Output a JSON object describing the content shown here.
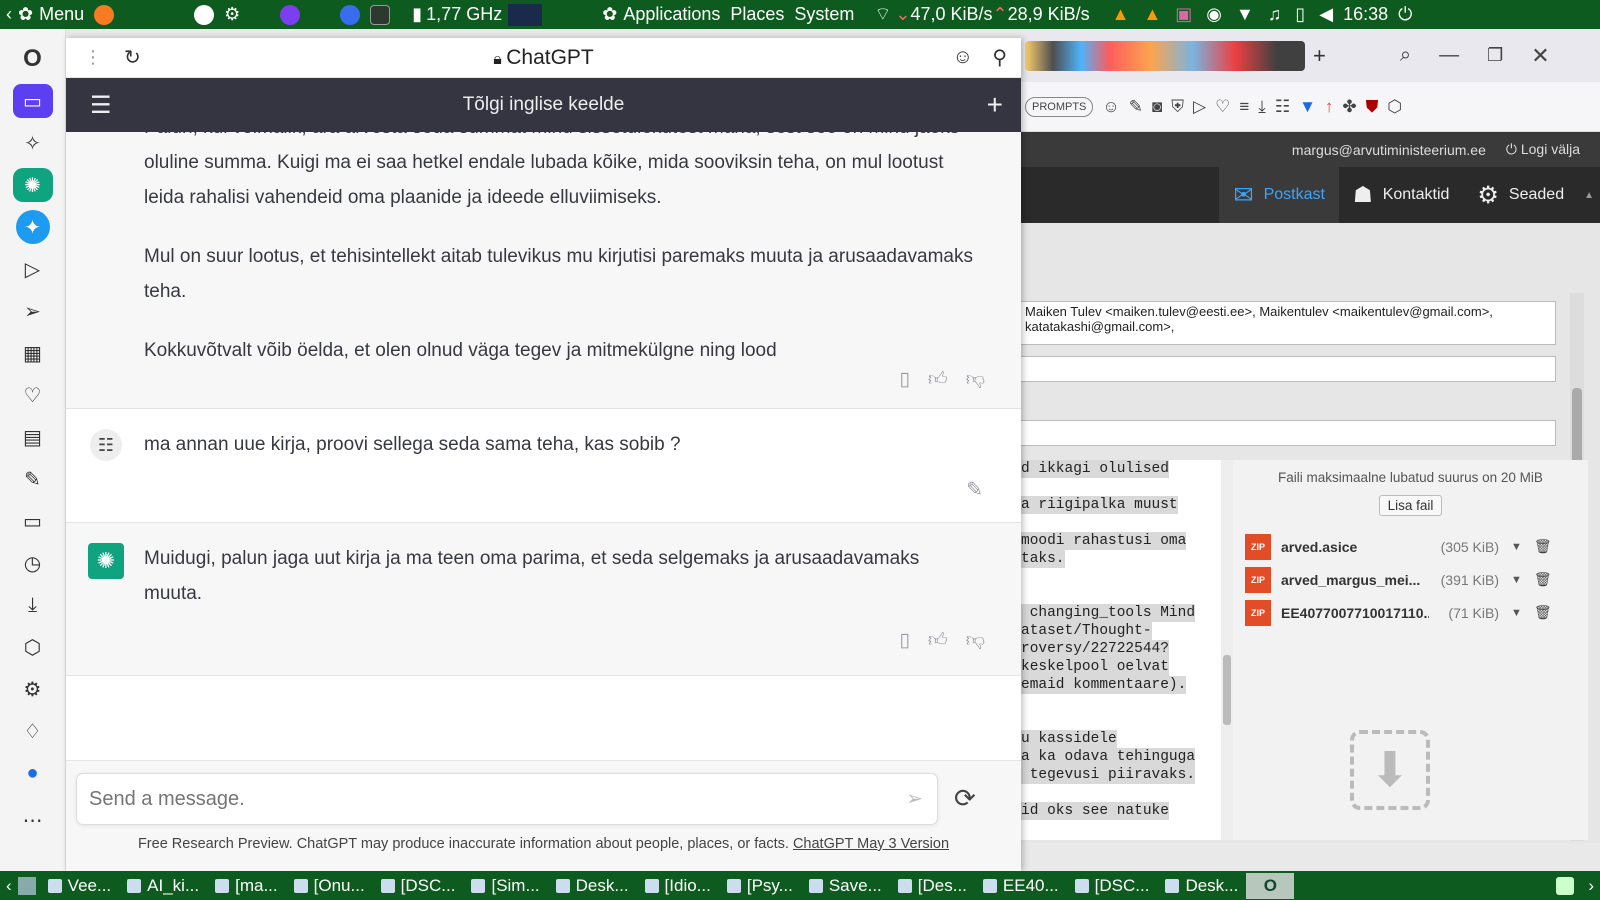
{
  "system": {
    "menu_label": "Menu",
    "cpu_freq": "1,77 GHz",
    "applications": "Applications",
    "places": "Places",
    "system_label": "System",
    "net_down": "47,0 KiB/s",
    "net_up": "28,9 KiB/s",
    "clock": "16:38"
  },
  "popup": {
    "title": "ChatGPT",
    "chat_title": "Tõlgi inglise keelde",
    "message1_paragraphs": [
      "Palun, kui võimalik, ära arvesta seda summat minu sissetulekutest maha, sest see on minu jaoks oluline summa. Kuigi ma ei saa hetkel endale lubada kõike, mida sooviksin teha, on mul lootust leida rahalisi vahendeid oma plaanide ja ideede elluviimiseks.",
      "Mul on suur lootus, et tehisintellekt aitab tulevikus mu kirjutisi paremaks muuta ja arusaadavamaks teha.",
      "Kokkuvõtvalt võib öelda, et olen olnud väga tegev ja mitmekülgne ning lood"
    ],
    "user_message": "ma annan uue kirja, proovi sellega seda sama teha, kas sobib ?",
    "ai_reply": "Muidugi, palun jaga uut kirja ja ma teen oma parima, et seda selgemaks ja arusaadavamaks muuta.",
    "input_placeholder": "Send a message.",
    "disclaimer": "Free Research Preview. ChatGPT may produce inaccurate information about people, places, or facts.",
    "version_link": "ChatGPT May 3 Version"
  },
  "toolbar": {
    "prompts_label": "PROMPTS"
  },
  "mail": {
    "user_email": "margus@arvutiministeerium.ee",
    "logout": "Logi välja",
    "nav": [
      "Postkast",
      "Kontaktid",
      "Seaded"
    ],
    "recipients": "Maiken Tulev <maiken.tulev@eesti.ee>, Maikentulev <maikentulev@gmail.com>, katatakashi@gmail.com>,",
    "editor_lines": [
      "d ikkagi olulised",
      "",
      "a riigipalka muust",
      "",
      "moodi rahastusi oma",
      "taks.",
      "",
      "",
      " changing_tools Mind",
      "ataset/Thought-",
      "roversy/22722544?",
      "keskelpool oelvat",
      "emaid kommentaare).",
      "",
      "",
      "u kassidele",
      "a ka odava tehinguga",
      " tegevusi piiravaks.",
      "",
      "id oks see natuke"
    ],
    "max_size_note": "Faili maksimaalne lubatud suurus on 20 MiB",
    "add_file": "Lisa fail",
    "attachments": [
      {
        "name": "arved.asice",
        "size": "(305 KiB)"
      },
      {
        "name": "arved_margus_mei...",
        "size": "(391 KiB)"
      },
      {
        "name": "EE4077007710017110...",
        "size": "(71 KiB)"
      }
    ]
  },
  "taskbar": {
    "tasks": [
      "Vee...",
      "AI_ki...",
      "[ma...",
      "[Onu...",
      "[DSC...",
      "[Sim...",
      "Desk...",
      "[Idio...",
      "[Psy...",
      "Save...",
      "[Des...",
      "EE40...",
      "[DSC...",
      "Desk..."
    ]
  }
}
